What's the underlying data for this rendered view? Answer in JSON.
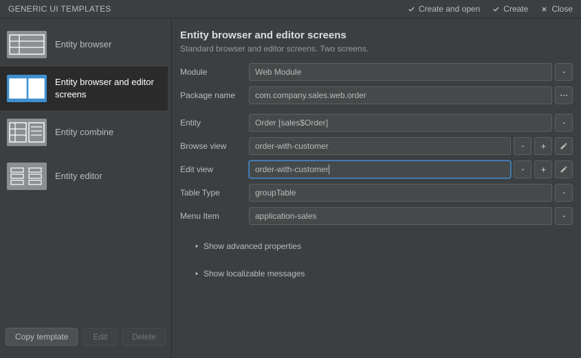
{
  "titlebar": {
    "title": "GENERIC UI TEMPLATES",
    "actions": {
      "create_open": "Create and open",
      "create": "Create",
      "close": "Close"
    }
  },
  "sidebar": {
    "items": [
      {
        "label": "Entity browser"
      },
      {
        "label": "Entity browser and editor screens"
      },
      {
        "label": "Entity combine"
      },
      {
        "label": "Entity editor"
      }
    ],
    "buttons": {
      "copy": "Copy template",
      "edit": "Edit",
      "delete": "Delete"
    }
  },
  "content": {
    "title": "Entity browser and editor screens",
    "subtitle": "Standard browser and editor screens. Two screens.",
    "fields": {
      "module": {
        "label": "Module",
        "value": "Web Module"
      },
      "package": {
        "label": "Package name",
        "value": "com.company.sales.web.order"
      },
      "entity": {
        "label": "Entity",
        "value": "Order [sales$Order]"
      },
      "browse_view": {
        "label": "Browse view",
        "value": "order-with-customer"
      },
      "edit_view": {
        "label": "Edit view",
        "value": "order-with-customer"
      },
      "table_type": {
        "label": "Table Type",
        "value": "groupTable"
      },
      "menu_item": {
        "label": "Menu Item",
        "value": "application-sales"
      }
    },
    "expanders": {
      "advanced": "Show advanced properties",
      "localizable": "Show localizable messages"
    }
  }
}
